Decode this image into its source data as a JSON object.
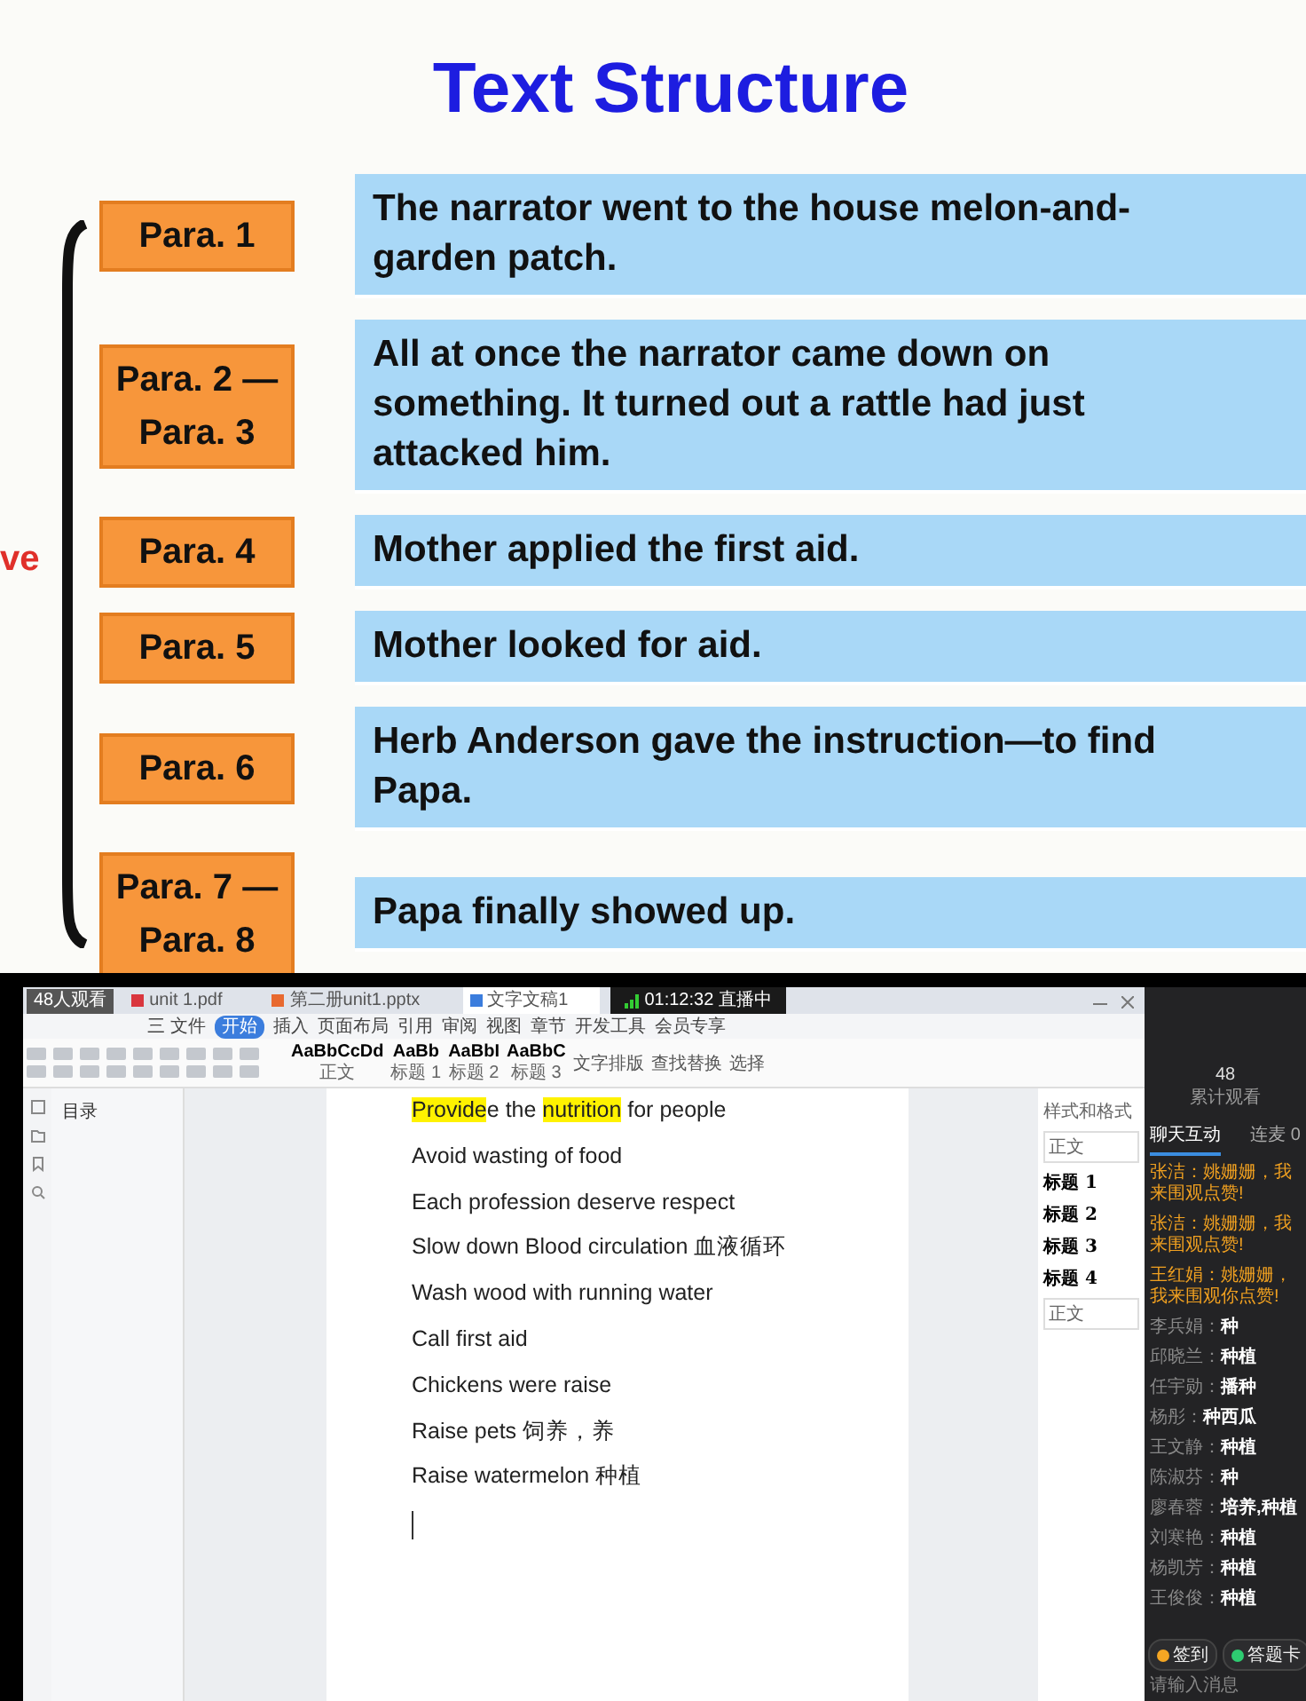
{
  "slide": {
    "title": "Text Structure",
    "side_label": "ve",
    "rows": [
      {
        "para": "Para. 1",
        "text": "The narrator went to the house melon-and-garden patch."
      },
      {
        "para": "Para. 2 —\nPara. 3",
        "text": "All at once the narrator came down on something. It turned out a rattle had just attacked him."
      },
      {
        "para": "Para. 4",
        "text": "Mother applied the first aid."
      },
      {
        "para": "Para. 5",
        "text": "Mother looked for aid."
      },
      {
        "para": "Para. 6",
        "text": "Herb Anderson gave the instruction—to find Papa."
      },
      {
        "para": "Para. 7 —\nPara. 8",
        "text": "Papa finally showed up."
      }
    ]
  },
  "screen": {
    "viewers": "48人观看",
    "live": "01:12:32 直播中",
    "tabs": [
      {
        "label": "unit 1.pdf",
        "kind": "pdf",
        "selected": false
      },
      {
        "label": "第二册unit1.pptx",
        "kind": "ppt",
        "selected": false
      },
      {
        "label": "文字文稿1",
        "kind": "doc",
        "selected": true
      }
    ],
    "menu": [
      {
        "label": "三 文件",
        "selected": false
      },
      {
        "label": "开始",
        "selected": true
      },
      {
        "label": "插入",
        "selected": false
      },
      {
        "label": "页面布局",
        "selected": false
      },
      {
        "label": "引用",
        "selected": false
      },
      {
        "label": "审阅",
        "selected": false
      },
      {
        "label": "视图",
        "selected": false
      },
      {
        "label": "章节",
        "selected": false
      },
      {
        "label": "开发工具",
        "selected": false
      },
      {
        "label": "会员专享",
        "selected": false
      }
    ],
    "style_gallery": [
      {
        "sample": "AaBbCcDd",
        "name": "正文"
      },
      {
        "sample": "AaBb",
        "name": "标题 1"
      },
      {
        "sample": "AaBbI",
        "name": "标题 2"
      },
      {
        "sample": "AaBbC",
        "name": "标题 3"
      }
    ],
    "tools": [
      "文字排版",
      "查找替换",
      "选择"
    ],
    "nav_title": "目录",
    "document": [
      {
        "parts": [
          {
            "text": "Provide",
            "highlight": true
          },
          {
            "text": "e the ",
            "highlight": false
          },
          {
            "text": "nutrition",
            "highlight": true
          },
          {
            "text": " for people",
            "highlight": false
          }
        ]
      },
      {
        "parts": [
          {
            "text": "Avoid wasting of food",
            "highlight": false
          }
        ]
      },
      {
        "parts": [
          {
            "text": "Each profession deserve respect",
            "highlight": false
          }
        ]
      },
      {
        "parts": [
          {
            "text": "Slow down Blood circulation  血液循环",
            "highlight": false
          }
        ]
      },
      {
        "parts": [
          {
            "text": "Wash wood with running water",
            "highlight": false
          }
        ]
      },
      {
        "parts": [
          {
            "text": "Call first aid",
            "highlight": false
          }
        ]
      },
      {
        "parts": [
          {
            "text": "Chickens were raise",
            "highlight": false
          }
        ]
      },
      {
        "parts": [
          {
            "text": "Raise pets  饲养，养",
            "highlight": false
          }
        ]
      },
      {
        "parts": [
          {
            "text": "Raise watermelon  种植",
            "highlight": false
          }
        ]
      }
    ],
    "styles_pane": {
      "title": "样式和格式",
      "current": "正文",
      "headings": [
        "标题 1",
        "标题 2",
        "标题 3",
        "标题 4"
      ],
      "bottom": "正文"
    },
    "chat": {
      "count": "48",
      "count_label": "累计观看",
      "tabs": [
        {
          "label": "聊天互动",
          "selected": true
        },
        {
          "label": "连麦 0",
          "selected": false
        }
      ],
      "messages": [
        {
          "name": "张洁：",
          "text": "姚姗姗，我来围观点赞!",
          "kind": "system"
        },
        {
          "name": "张洁：",
          "text": "姚姗姗，我来围观点赞!",
          "kind": "system"
        },
        {
          "name": "王红娟：",
          "text": "姚姗姗，我来围观你点赞!",
          "kind": "system"
        },
        {
          "name": "李兵娟：",
          "text": "种",
          "kind": "user"
        },
        {
          "name": "邱晓兰：",
          "text": "种植",
          "kind": "user"
        },
        {
          "name": "任宇勋：",
          "text": "播种",
          "kind": "user"
        },
        {
          "name": "杨彤：",
          "text": "种西瓜",
          "kind": "user"
        },
        {
          "name": "王文静：",
          "text": "种植",
          "kind": "user"
        },
        {
          "name": "陈淑芬：",
          "text": "种",
          "kind": "user"
        },
        {
          "name": "廖春蓉：",
          "text": "培养,种植",
          "kind": "user"
        },
        {
          "name": "刘寒艳：",
          "text": "种植",
          "kind": "user"
        },
        {
          "name": "杨凯芳：",
          "text": "种植",
          "kind": "user"
        },
        {
          "name": "王俊俊：",
          "text": "种植",
          "kind": "user"
        }
      ],
      "buttons": [
        {
          "label": "签到",
          "color": "#f5a623"
        },
        {
          "label": "答题卡",
          "color": "#2ecc71"
        }
      ],
      "placeholder": "请输入消息"
    }
  }
}
